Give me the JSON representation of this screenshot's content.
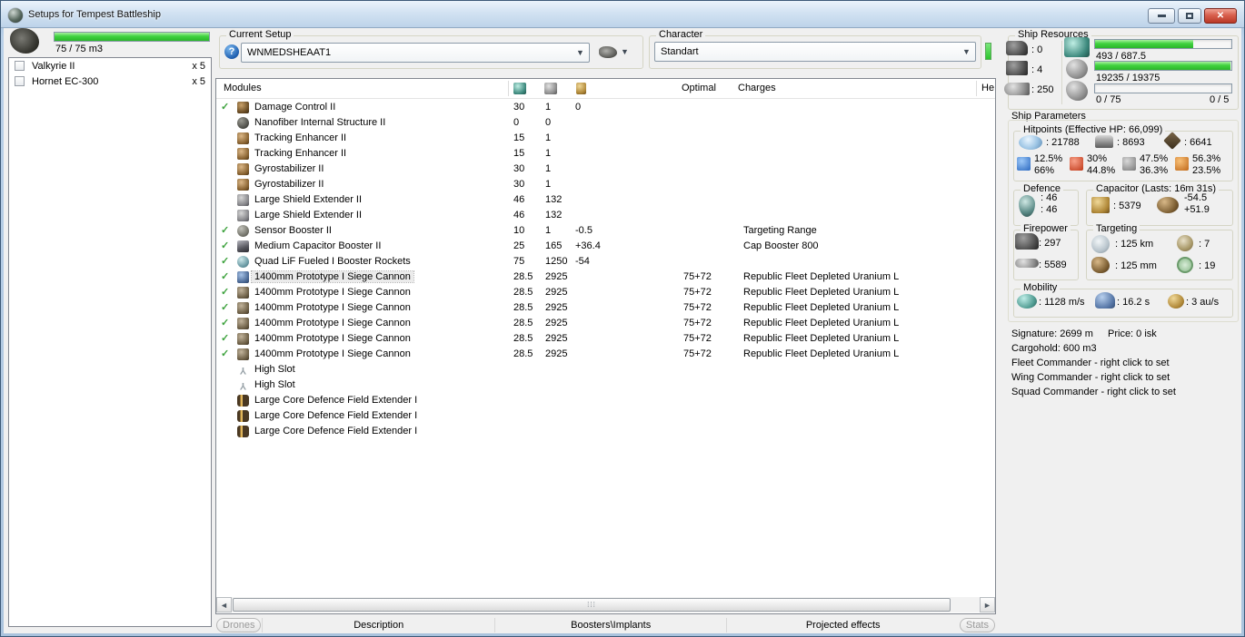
{
  "window": {
    "title": "Setups for Tempest Battleship"
  },
  "colors": {
    "progress_green": "#3fd23f",
    "character_indicator": "#2cc42c",
    "fitted_check": "#3da23d",
    "close_button_red": "#b93826"
  },
  "drone_bay": {
    "capacity": "75 / 75 m3",
    "items": [
      {
        "name": "Valkyrie II",
        "qty": "x 5"
      },
      {
        "name": "Hornet EC-300",
        "qty": "x 5"
      }
    ]
  },
  "current_setup": {
    "label": "Current Setup",
    "value": "WNMEDSHEAAT1"
  },
  "character": {
    "label": "Character",
    "value": "Standart"
  },
  "ship_resources": {
    "title": "Ship Resources",
    "turret_hardpoints": "0",
    "launcher_hardpoints": "4",
    "calibration": "250",
    "cpu": "493 / 687.5",
    "powergrid": "19235 / 19375",
    "dronebay": "0 / 75",
    "drones": "0 / 5",
    "cpu_fill_pct": 72,
    "powergrid_fill_pct": 99,
    "dronebay_fill_pct": 0
  },
  "modules_table": {
    "title": "Modules",
    "columns": {
      "optimal": "Optimal",
      "charges": "Charges",
      "heat": "He"
    },
    "rows": [
      {
        "fitted": true,
        "selected": false,
        "icon": "damage-control",
        "name": "Damage Control II",
        "cpu": "30",
        "pg": "1",
        "cap": "0",
        "optimal": "",
        "charges": ""
      },
      {
        "fitted": false,
        "selected": false,
        "icon": "nanofiber",
        "name": "Nanofiber Internal Structure II",
        "cpu": "0",
        "pg": "0",
        "cap": "",
        "optimal": "",
        "charges": ""
      },
      {
        "fitted": false,
        "selected": false,
        "icon": "tracking-enhancer",
        "name": "Tracking Enhancer II",
        "cpu": "15",
        "pg": "1",
        "cap": "",
        "optimal": "",
        "charges": ""
      },
      {
        "fitted": false,
        "selected": false,
        "icon": "tracking-enhancer",
        "name": "Tracking Enhancer II",
        "cpu": "15",
        "pg": "1",
        "cap": "",
        "optimal": "",
        "charges": ""
      },
      {
        "fitted": false,
        "selected": false,
        "icon": "gyrostabilizer",
        "name": "Gyrostabilizer II",
        "cpu": "30",
        "pg": "1",
        "cap": "",
        "optimal": "",
        "charges": ""
      },
      {
        "fitted": false,
        "selected": false,
        "icon": "gyrostabilizer",
        "name": "Gyrostabilizer II",
        "cpu": "30",
        "pg": "1",
        "cap": "",
        "optimal": "",
        "charges": ""
      },
      {
        "fitted": false,
        "selected": false,
        "icon": "shield-extender",
        "name": "Large Shield Extender II",
        "cpu": "46",
        "pg": "132",
        "cap": "",
        "optimal": "",
        "charges": ""
      },
      {
        "fitted": false,
        "selected": false,
        "icon": "shield-extender",
        "name": "Large Shield Extender II",
        "cpu": "46",
        "pg": "132",
        "cap": "",
        "optimal": "",
        "charges": ""
      },
      {
        "fitted": true,
        "selected": false,
        "icon": "sensor-booster",
        "name": "Sensor Booster II",
        "cpu": "10",
        "pg": "1",
        "cap": "-0.5",
        "optimal": "",
        "charges": "Targeting Range"
      },
      {
        "fitted": true,
        "selected": false,
        "icon": "cap-booster",
        "name": "Medium Capacitor Booster II",
        "cpu": "25",
        "pg": "165",
        "cap": "+36.4",
        "optimal": "",
        "charges": "Cap Booster 800"
      },
      {
        "fitted": true,
        "selected": false,
        "icon": "afterburner",
        "name": "Quad LiF Fueled I Booster Rockets",
        "cpu": "75",
        "pg": "1250",
        "cap": "-54",
        "optimal": "",
        "charges": ""
      },
      {
        "fitted": true,
        "selected": true,
        "icon": "siege-cannon-selected",
        "name": "1400mm Prototype I Siege Cannon",
        "cpu": "28.5",
        "pg": "2925",
        "cap": "",
        "optimal": "75+72",
        "charges": "Republic Fleet Depleted Uranium L"
      },
      {
        "fitted": true,
        "selected": false,
        "icon": "siege-cannon",
        "name": "1400mm Prototype I Siege Cannon",
        "cpu": "28.5",
        "pg": "2925",
        "cap": "",
        "optimal": "75+72",
        "charges": "Republic Fleet Depleted Uranium L"
      },
      {
        "fitted": true,
        "selected": false,
        "icon": "siege-cannon",
        "name": "1400mm Prototype I Siege Cannon",
        "cpu": "28.5",
        "pg": "2925",
        "cap": "",
        "optimal": "75+72",
        "charges": "Republic Fleet Depleted Uranium L"
      },
      {
        "fitted": true,
        "selected": false,
        "icon": "siege-cannon",
        "name": "1400mm Prototype I Siege Cannon",
        "cpu": "28.5",
        "pg": "2925",
        "cap": "",
        "optimal": "75+72",
        "charges": "Republic Fleet Depleted Uranium L"
      },
      {
        "fitted": true,
        "selected": false,
        "icon": "siege-cannon",
        "name": "1400mm Prototype I Siege Cannon",
        "cpu": "28.5",
        "pg": "2925",
        "cap": "",
        "optimal": "75+72",
        "charges": "Republic Fleet Depleted Uranium L"
      },
      {
        "fitted": true,
        "selected": false,
        "icon": "siege-cannon",
        "name": "1400mm Prototype I Siege Cannon",
        "cpu": "28.5",
        "pg": "2925",
        "cap": "",
        "optimal": "75+72",
        "charges": "Republic Fleet Depleted Uranium L"
      },
      {
        "fitted": false,
        "selected": false,
        "icon": "high-slot",
        "name": "High Slot",
        "cpu": "",
        "pg": "",
        "cap": "",
        "optimal": "",
        "charges": ""
      },
      {
        "fitted": false,
        "selected": false,
        "icon": "high-slot",
        "name": "High Slot",
        "cpu": "",
        "pg": "",
        "cap": "",
        "optimal": "",
        "charges": ""
      },
      {
        "fitted": false,
        "selected": false,
        "icon": "rig",
        "name": "Large Core Defence Field Extender I",
        "cpu": "",
        "pg": "",
        "cap": "",
        "optimal": "",
        "charges": ""
      },
      {
        "fitted": false,
        "selected": false,
        "icon": "rig",
        "name": "Large Core Defence Field Extender I",
        "cpu": "",
        "pg": "",
        "cap": "",
        "optimal": "",
        "charges": ""
      },
      {
        "fitted": false,
        "selected": false,
        "icon": "rig",
        "name": "Large Core Defence Field Extender I",
        "cpu": "",
        "pg": "",
        "cap": "",
        "optimal": "",
        "charges": ""
      }
    ]
  },
  "ship_parameters": {
    "title": "Ship Parameters",
    "hitpoints": {
      "title": "Hitpoints (Effective HP: 66,099)",
      "shield": "21788",
      "armor": "8693",
      "hull": "6641",
      "resists": [
        {
          "type": "em",
          "value1": "12.5%",
          "value2": "66%"
        },
        {
          "type": "thermal",
          "value1": "30%",
          "value2": "44.8%"
        },
        {
          "type": "kinetic",
          "value1": "47.5%",
          "value2": "36.3%"
        },
        {
          "type": "explosive",
          "value1": "56.3%",
          "value2": "23.5%"
        }
      ]
    },
    "defence": {
      "title": "Defence",
      "value1": "46",
      "value2": "46"
    },
    "capacitor": {
      "title": "Capacitor (Lasts: 16m 31s)",
      "amount": "5379",
      "drain": "-54.5",
      "recharge": "+51.9"
    },
    "firepower": {
      "title": "Firepower",
      "turret_dps": "297",
      "volley": "5589"
    },
    "targeting": {
      "title": "Targeting",
      "range": "125 km",
      "max_targets": "7",
      "scan_resolution": "125 mm",
      "sensor_strength": "19"
    },
    "mobility": {
      "title": "Mobility",
      "speed": "1128 m/s",
      "align_time": "16.2 s",
      "warp_speed": "3 au/s"
    },
    "signature": "Signature: 2699 m",
    "price": "Price: 0 isk",
    "cargohold": "Cargohold: 600 m3",
    "fleet_commander": "Fleet Commander - right click to set",
    "wing_commander": "Wing Commander - right click to set",
    "squad_commander": "Squad Commander - right click to set"
  },
  "footer": {
    "drones_button": "Drones",
    "tabs": [
      "Description",
      "Boosters\\Implants",
      "Projected effects"
    ],
    "stats_button": "Stats"
  }
}
